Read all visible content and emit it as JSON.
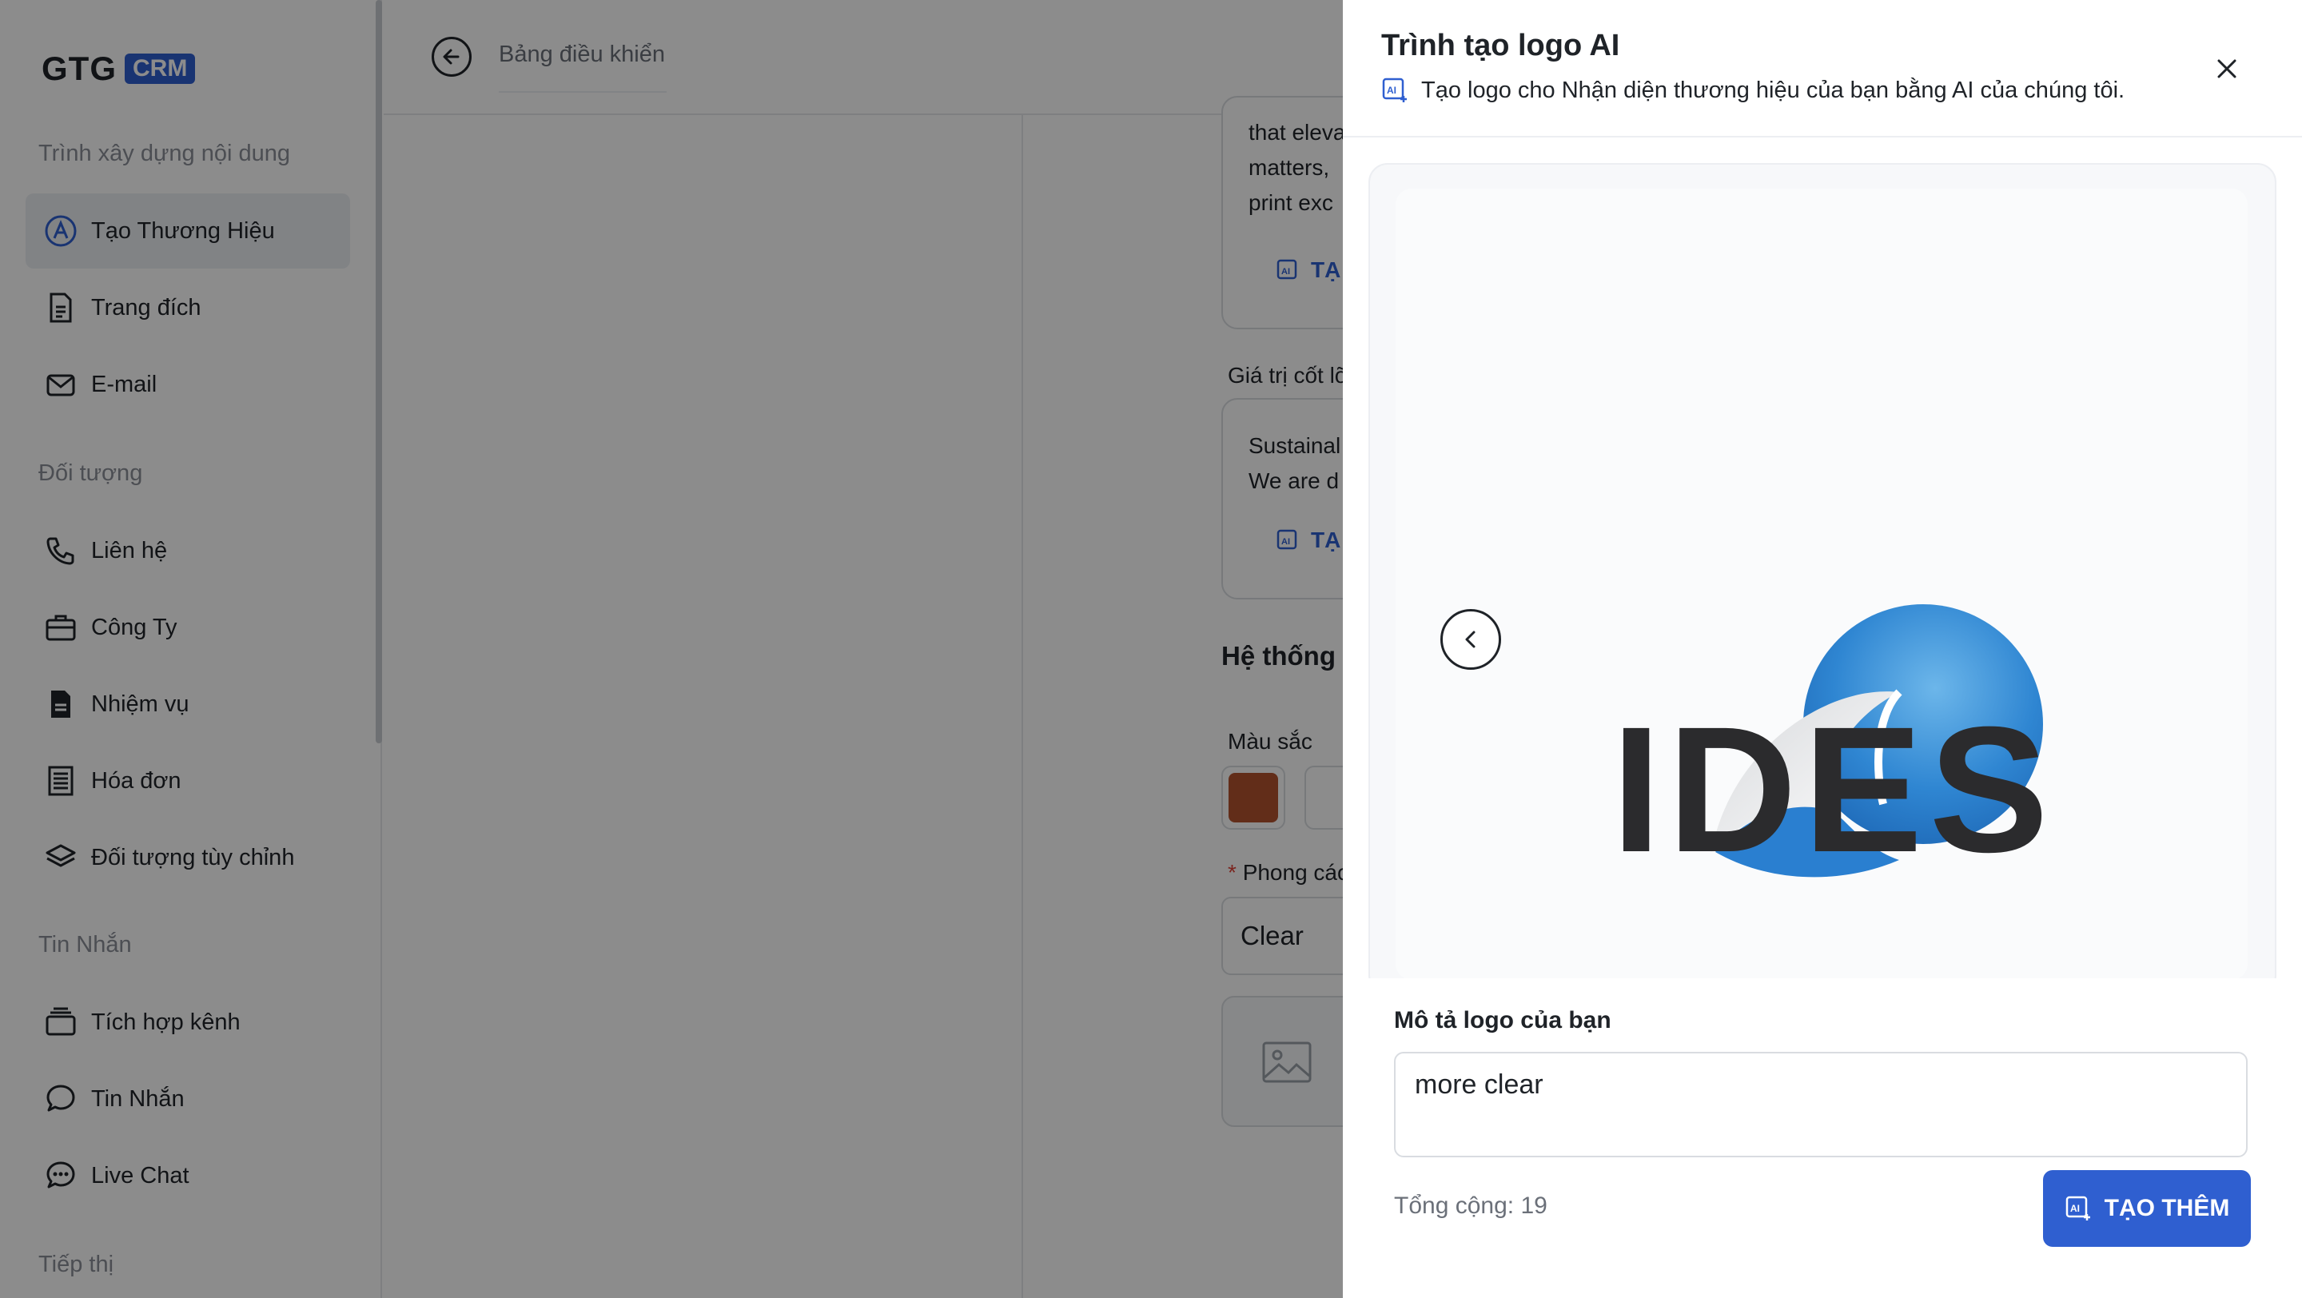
{
  "brand": {
    "name": "GTG",
    "badge": "CRM",
    "accent": "#2f5fd0"
  },
  "sidebar": {
    "sections": [
      {
        "title": "Trình xây dựng nội dung",
        "items": [
          {
            "label": "Tạo Thương Hiệu",
            "icon": "brand-icon",
            "active": true
          },
          {
            "label": "Trang đích",
            "icon": "document-icon"
          },
          {
            "label": "E-mail",
            "icon": "mail-icon"
          }
        ]
      },
      {
        "title": "Đối tượng",
        "items": [
          {
            "label": "Liên hệ",
            "icon": "phone-icon"
          },
          {
            "label": "Công Ty",
            "icon": "briefcase-icon"
          },
          {
            "label": "Nhiệm vụ",
            "icon": "task-icon"
          },
          {
            "label": "Hóa đơn",
            "icon": "invoice-icon"
          },
          {
            "label": "Đối tượng tùy chỉnh",
            "icon": "layers-icon"
          }
        ]
      },
      {
        "title": "Tin Nhắn",
        "items": [
          {
            "label": "Tích hợp kênh",
            "icon": "channels-icon"
          },
          {
            "label": "Tin Nhắn",
            "icon": "chat-bubble-icon"
          },
          {
            "label": "Live Chat",
            "icon": "live-chat-icon"
          }
        ]
      },
      {
        "title": "Tiếp thị",
        "items": []
      }
    ]
  },
  "header": {
    "breadcrumb": "Bảng điều khiển"
  },
  "main": {
    "text_lines": [
      "that eleva",
      "matters,",
      "print exc"
    ],
    "ai_link_1": "TẠ",
    "core_values_label": "Giá trị cốt lõ",
    "core_values_lines": [
      "Sustainal",
      "We are d"
    ],
    "ai_link_2": "TẠ",
    "system_heading": "Hệ thống",
    "color_label": "Màu sắc",
    "color_primary": "#b3532e",
    "style_label": "Phong các",
    "style_required_mark": "*",
    "style_value": "Clear"
  },
  "drawer": {
    "title": "Trình tạo logo AI",
    "subtitle": "Tạo logo cho Nhận diện thương hiệu của bạn bằng AI của chúng tôi.",
    "preview_logo_text": "IDES",
    "description_label": "Mô tả logo của bạn",
    "description_value": "more clear",
    "total_text": "Tổng cộng: 19",
    "generate_button": "TẠO THÊM"
  }
}
